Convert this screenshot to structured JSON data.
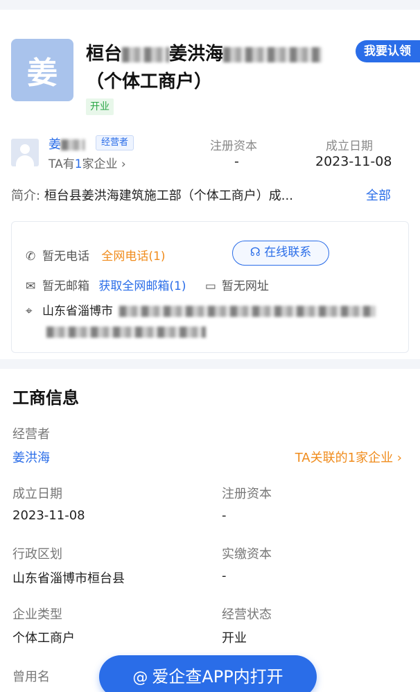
{
  "header": {
    "logo_char": "姜",
    "company_name_prefix": "桓台",
    "company_name_mid": "姜洪海",
    "company_name_line2": "（个体工商户）",
    "claim_label": "我要认领",
    "status": "开业"
  },
  "person": {
    "name": "姜",
    "role": "经营者",
    "sub_prefix": "TA有",
    "sub_count": "1",
    "sub_suffix": "家企业 ›"
  },
  "meta": {
    "capital_label": "注册资本",
    "capital_value": "-",
    "founded_label": "成立日期",
    "founded_value": "2023-11-08"
  },
  "intro": {
    "label": "简介:",
    "text": "桓台县姜洪海建筑施工部（个体工商户）成...",
    "all": "全部"
  },
  "contact": {
    "phone_none": "暂无电话",
    "phone_all": "全网电话(1)",
    "online": "在线联系",
    "email_none": "暂无邮箱",
    "email_get": "获取全网邮箱(1)",
    "web_none": "暂无网址",
    "address_prefix": "山东省淄博市"
  },
  "business": {
    "title": "工商信息",
    "operator_label": "经营者",
    "operator_value": "姜洪海",
    "related": "TA关联的1家企业 ›",
    "founded_label": "成立日期",
    "founded_value": "2023-11-08",
    "capital_label": "注册资本",
    "capital_value": "-",
    "region_label": "行政区划",
    "region_value": "山东省淄博市桓台县",
    "paid_label": "实缴资本",
    "paid_value": "-",
    "type_label": "企业类型",
    "type_value": "个体工商户",
    "status_label": "经营状态",
    "status_value": "开业",
    "former_label": "曾用名"
  },
  "app_button": {
    "icon": "at-icon",
    "label": "爱企查APP内打开"
  }
}
